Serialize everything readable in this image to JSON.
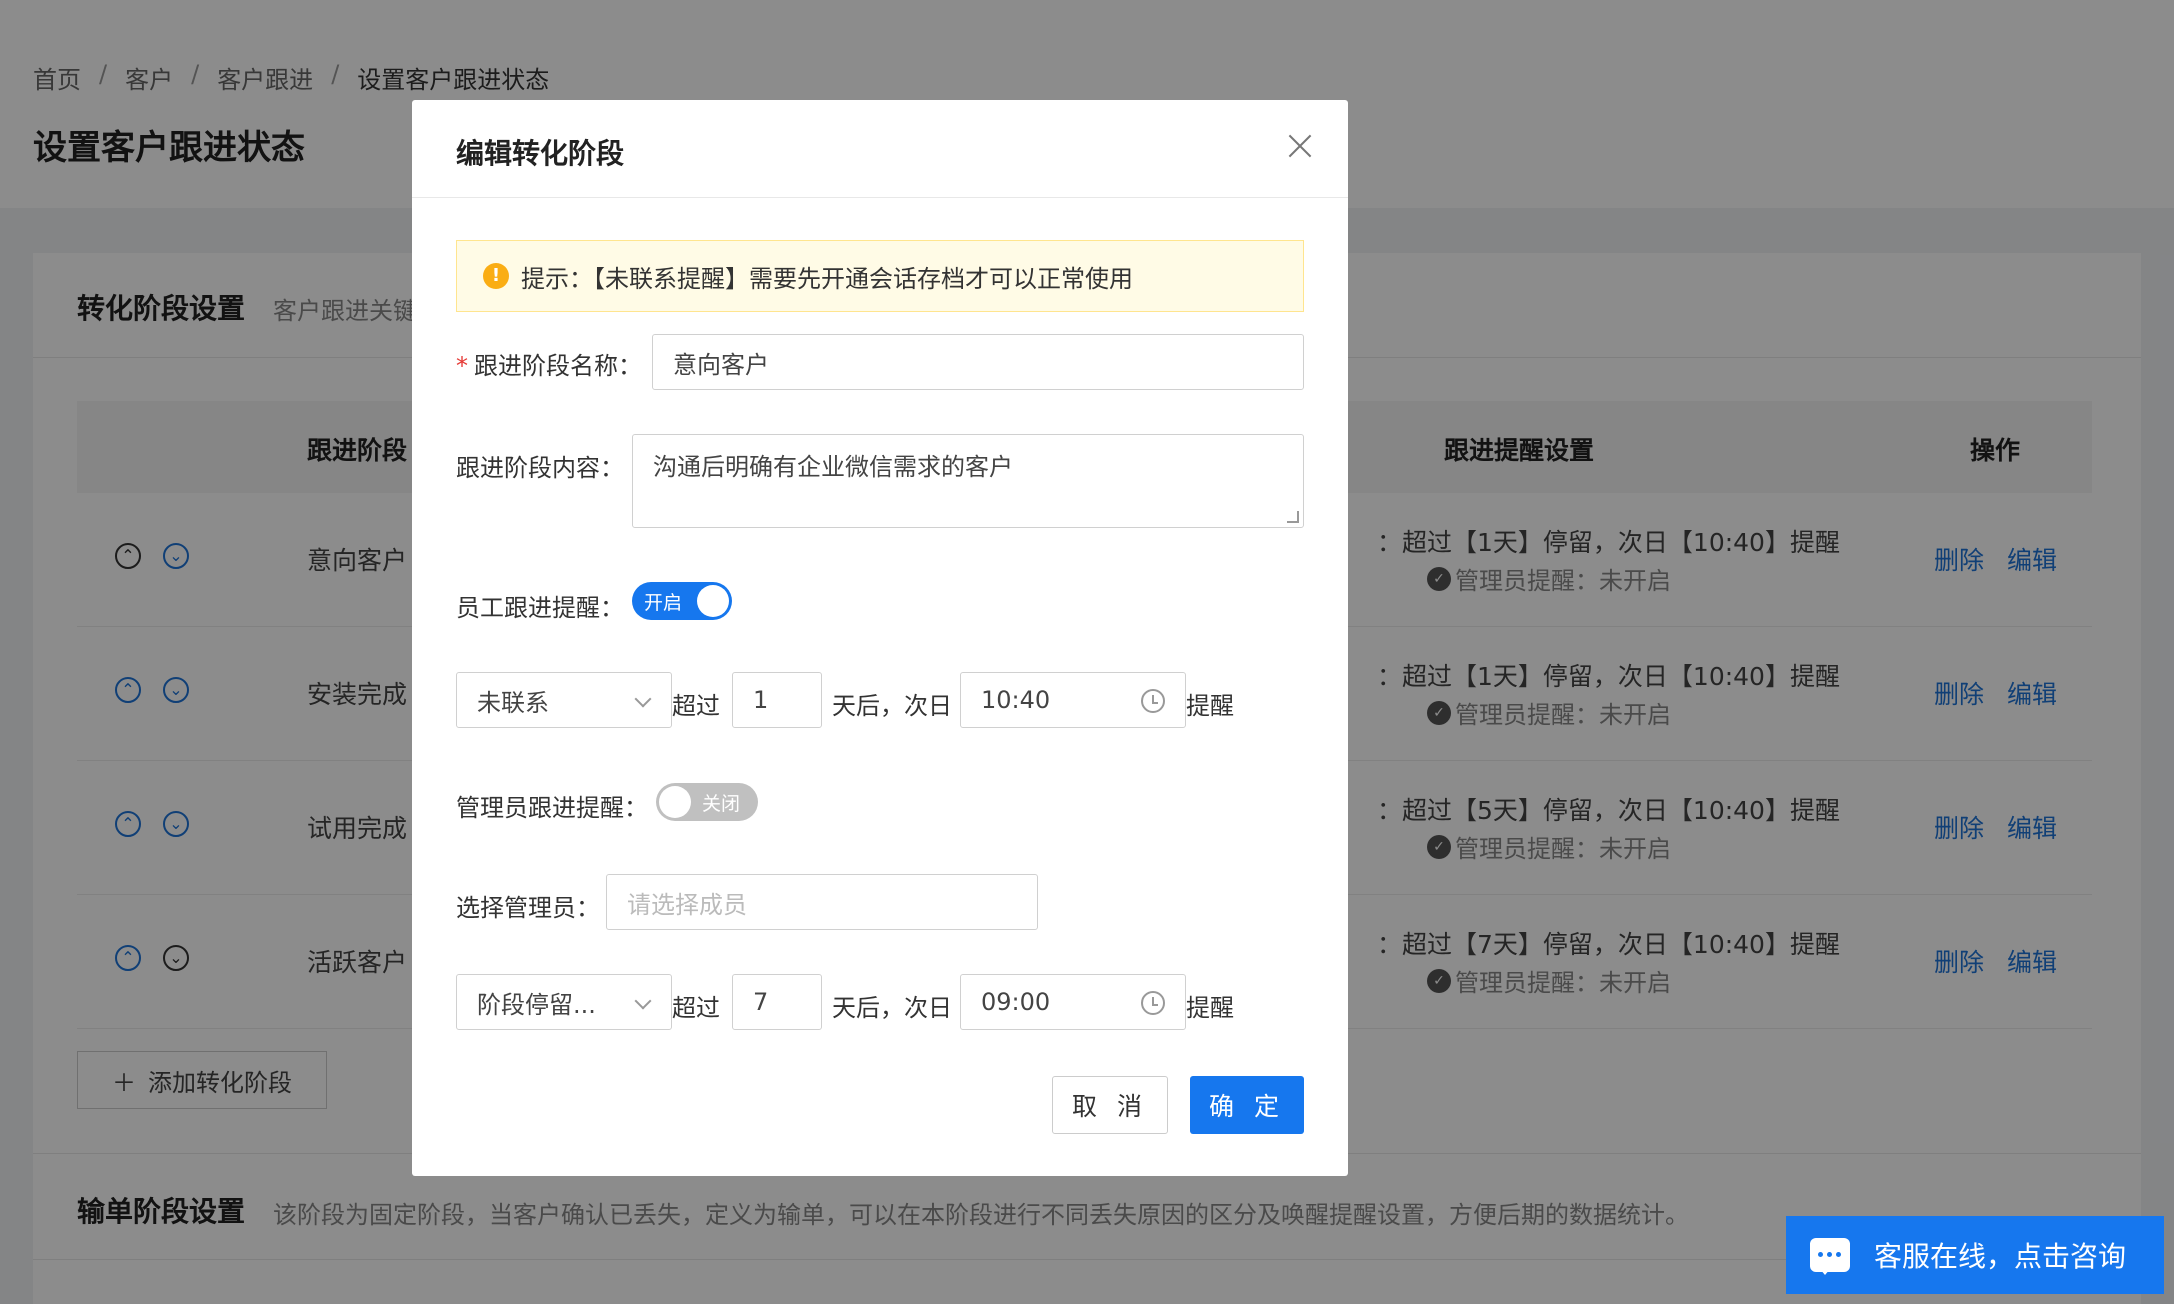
{
  "breadcrumb": [
    "首页",
    "客户",
    "客户跟进",
    "设置客户跟进状态"
  ],
  "page_title": "设置客户跟进状态",
  "section1": {
    "title": "转化阶段设置",
    "desc": "客户跟进关键"
  },
  "table": {
    "headers": {
      "stage": "跟进阶段",
      "remind": "跟进提醒设置",
      "ops": "操作"
    },
    "rows": [
      {
        "stage": "意向客户",
        "remind1": "：超过【1天】停留，次日【10:40】提醒",
        "remind2": "管理员提醒：未开启",
        "delete": "删除",
        "edit": "编辑"
      },
      {
        "stage": "安装完成",
        "remind1": "：超过【1天】停留，次日【10:40】提醒",
        "remind2": "管理员提醒：未开启",
        "delete": "删除",
        "edit": "编辑"
      },
      {
        "stage": "试用完成",
        "remind1": "：超过【5天】停留，次日【10:40】提醒",
        "remind2": "管理员提醒：未开启",
        "delete": "删除",
        "edit": "编辑"
      },
      {
        "stage": "活跃客户",
        "remind1": "：超过【7天】停留，次日【10:40】提醒",
        "remind2": "管理员提醒：未开启",
        "delete": "删除",
        "edit": "编辑"
      }
    ]
  },
  "add_button": "添加转化阶段",
  "section2": {
    "title": "输单阶段设置",
    "desc": "该阶段为固定阶段，当客户确认已丢失，定义为输单，可以在本阶段进行不同丢失原因的区分及唤醒提醒设置，方便后期的数据统计。"
  },
  "chat": {
    "label": "客服在线，点击咨询"
  },
  "modal": {
    "title": "编辑转化阶段",
    "alert": "提示：【未联系提醒】需要先开通会话存档才可以正常使用",
    "name_label": "跟进阶段名称：",
    "name_value": "意向客户",
    "content_label": "跟进阶段内容：",
    "content_value": "沟通后明确有企业微信需求的客户",
    "staff_label": "员工跟进提醒：",
    "staff_toggle": "开启",
    "rule1": {
      "select": "未联系",
      "over": "超过",
      "days": "1",
      "after": "天后，次日",
      "time": "10:40",
      "remind": "提醒"
    },
    "admin_label": "管理员跟进提醒：",
    "admin_toggle": "关闭",
    "choose_admin_label": "选择管理员：",
    "choose_admin_placeholder": "请选择成员",
    "rule2": {
      "select": "阶段停留...",
      "over": "超过",
      "days": "7",
      "after": "天后，次日",
      "time": "09:00",
      "remind": "提醒"
    },
    "cancel": "取 消",
    "ok": "确 定"
  },
  "colors": {
    "primary": "#1677ee",
    "warning": "#faad14",
    "required": "#e53935"
  }
}
